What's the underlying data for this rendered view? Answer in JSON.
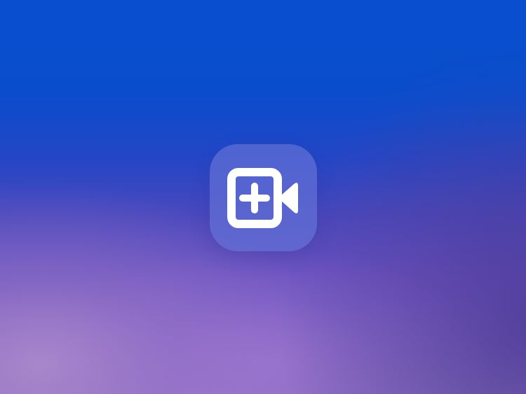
{
  "screen": {
    "app_icon": {
      "icon": "video-add-icon",
      "label": ""
    },
    "colors": {
      "background_top": "#0a4fcd",
      "background_bottom": "#8a6fbe",
      "tile_fill": "#6270d6",
      "glyph": "#ffffff"
    }
  }
}
